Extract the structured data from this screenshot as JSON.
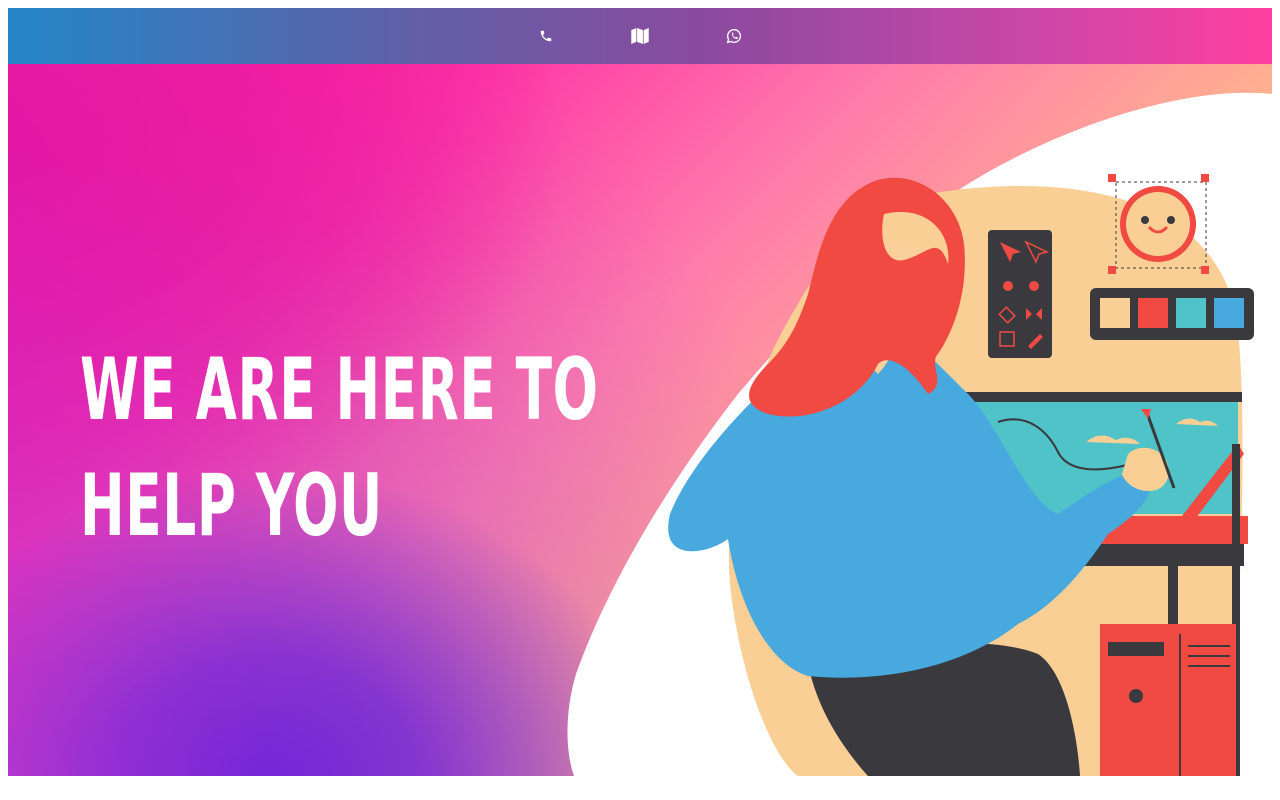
{
  "nav": {
    "phone_icon": "phone-icon",
    "map_icon": "map-icon",
    "whatsapp_icon": "whatsapp-icon"
  },
  "hero": {
    "title": "WE ARE HERE TO HELP YOU"
  },
  "colors": {
    "topbar_start": "#2386c8",
    "topbar_end": "#ff3f9f",
    "hero_pink": "#ff0d8f",
    "hero_purple": "#4a1fd6",
    "hero_yellow": "#ffe98a",
    "shirt_blue": "#47a9de",
    "hair_red": "#f04a42",
    "skin": "#f9d09a",
    "dark": "#3a3a3e"
  }
}
